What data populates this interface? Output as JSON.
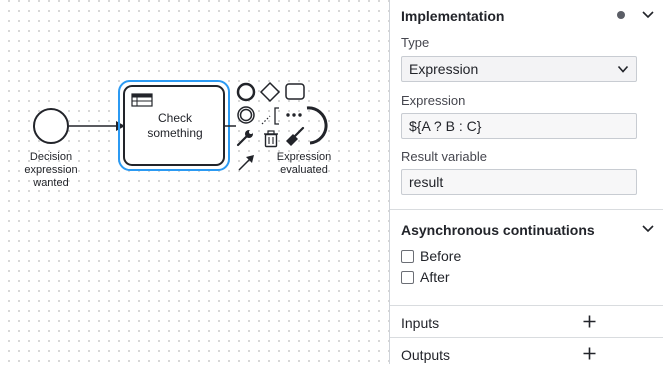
{
  "canvas": {
    "start_event_label": [
      "Decision",
      "expression",
      "wanted"
    ],
    "task_label": [
      "Check",
      "something"
    ],
    "end_event_label": [
      "Expression",
      "evaluated"
    ]
  },
  "panel": {
    "implementation": {
      "title": "Implementation",
      "type_label": "Type",
      "type_value": "Expression",
      "expression_label": "Expression",
      "expression_value": "${A ? B : C}",
      "result_variable_label": "Result variable",
      "result_variable_value": "result"
    },
    "async": {
      "title": "Asynchronous continuations",
      "before_label": "Before",
      "after_label": "After",
      "before_checked": false,
      "after_checked": false
    },
    "inputs": {
      "title": "Inputs"
    },
    "outputs": {
      "title": "Outputs"
    }
  },
  "colors": {
    "selection": "#2b9af3",
    "stroke": "#22242a",
    "panel_border": "#cfd3d9"
  }
}
